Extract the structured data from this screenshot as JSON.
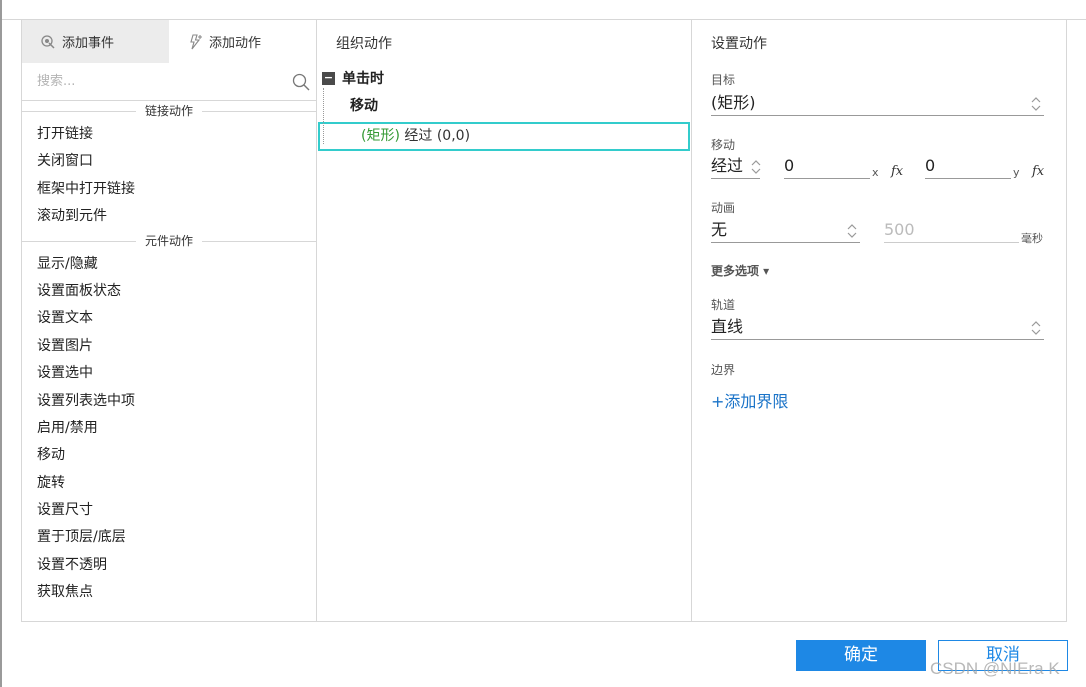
{
  "left": {
    "tabs": [
      {
        "label": "添加事件",
        "icon": "add-event-icon"
      },
      {
        "label": "添加动作",
        "icon": "add-action-icon"
      }
    ],
    "search_placeholder": "搜索...",
    "sections": [
      {
        "title": "链接动作",
        "items": [
          "打开链接",
          "关闭窗口",
          "框架中打开链接",
          "滚动到元件"
        ]
      },
      {
        "title": "元件动作",
        "items": [
          "显示/隐藏",
          "设置面板状态",
          "设置文本",
          "设置图片",
          "设置选中",
          "设置列表选中项",
          "启用/禁用",
          "移动",
          "旋转",
          "设置尺寸",
          "置于顶层/底层",
          "设置不透明",
          "获取焦点"
        ]
      }
    ]
  },
  "middle": {
    "title": "组织动作",
    "event": "单击时",
    "collapse_symbol": "−",
    "case": "移动",
    "action_target": "(矩形)",
    "action_desc": "经过 (0,0)"
  },
  "right": {
    "title": "设置动作",
    "target_label": "目标",
    "target_value": "(矩形)",
    "move_label": "移动",
    "move_type": "经过",
    "x_value": "0",
    "x_label": "x",
    "y_value": "0",
    "y_label": "y",
    "fx_label": "fx",
    "anim_label": "动画",
    "anim_value": "无",
    "duration_value": "500",
    "duration_unit": "毫秒",
    "more_options": "更多选项 ▾",
    "track_label": "轨道",
    "track_value": "直线",
    "bounds_label": "边界",
    "add_bounds": "+添加界限"
  },
  "footer": {
    "ok_label": "确定",
    "cancel_label": "取消",
    "watermark": "CSDN @NIEra K"
  },
  "colors": {
    "accent": "#1e88e5",
    "highlight_border": "#33cccc",
    "target_green": "#339933",
    "link_blue": "#1a73c8"
  }
}
